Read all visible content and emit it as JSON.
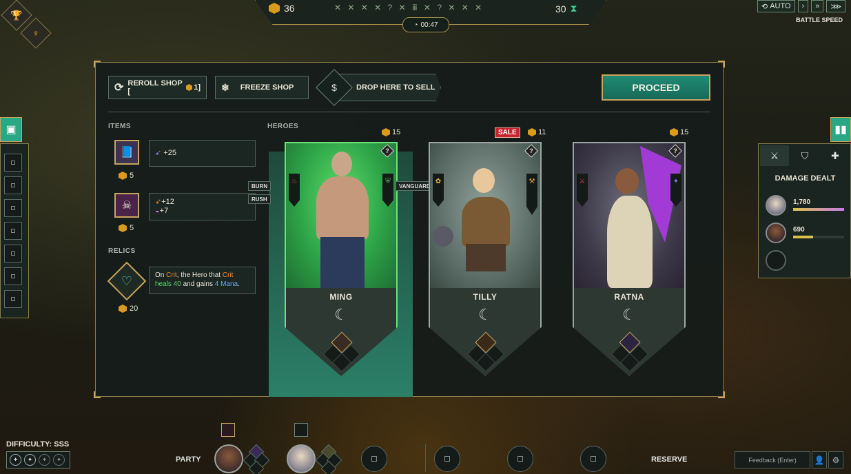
{
  "topbar": {
    "gold": "36",
    "stages": "✕ ✕ ✕ ✕ ? ✕ ⅲ ✕ ? ✕ ✕ ✕",
    "timer": "00:47",
    "count": "30"
  },
  "battle_speed": {
    "auto_label": "AUTO",
    "label": "BATTLE SPEED"
  },
  "shop": {
    "reroll_label": "REROLL SHOP [",
    "reroll_cost": "1]",
    "freeze_label": "FREEZE SHOP",
    "sell_label": "DROP HERE TO SELL",
    "proceed_label": "PROCEED"
  },
  "sections": {
    "items": "ITEMS",
    "relics": "RELICS",
    "heroes": "HEROES"
  },
  "items": [
    {
      "stat1": "+25",
      "cost": "5"
    },
    {
      "stat1": "+12",
      "stat2": "+7",
      "cost": "5"
    }
  ],
  "relic": {
    "text_1": "On ",
    "crit_1": "Crit",
    "text_2": ", the Hero that ",
    "crit_2": "Crit",
    "heal": "heals 40",
    "text_3": " and gains ",
    "mana": "4 Mana",
    "text_4": ".",
    "cost": "20"
  },
  "heroes": [
    {
      "name": "MING",
      "cost": "15",
      "tags": [
        "BURN",
        "RUSH"
      ]
    },
    {
      "name": "TILLY",
      "cost": "11",
      "sale": "SALE",
      "tag": "VANGUARD"
    },
    {
      "name": "RATNA",
      "cost": "15"
    }
  ],
  "damage": {
    "title": "DAMAGE DEALT",
    "rows": [
      {
        "value": "1,780",
        "fill": 1.0
      },
      {
        "value": "690",
        "fill": 0.39
      }
    ]
  },
  "bottom": {
    "difficulty": "DIFFICULTY: SSS",
    "party": "PARTY",
    "reserve": "RESERVE",
    "feedback": "Feedback (Enter)"
  },
  "colors": {
    "accent": "#2aa784",
    "gold": "#d9a227",
    "sale": "#c4262f"
  }
}
